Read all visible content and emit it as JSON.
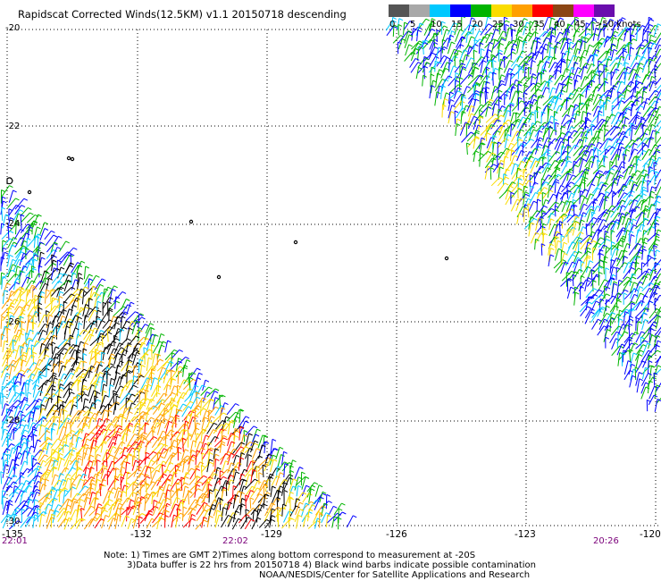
{
  "title": "Rapidscat Corrected Winds(12.5KM) v1.1 20150718 descending",
  "color_scale": {
    "labels": [
      "0",
      "5",
      "10",
      "15",
      "20",
      "25",
      "30",
      "35",
      "40",
      "45",
      ">50 knots"
    ],
    "colors": [
      "#555555",
      "#a8a8a8",
      "#00c8ff",
      "#0000ff",
      "#00b400",
      "#fadc00",
      "#ffa000",
      "#ff0000",
      "#8b4513",
      "#ff00ff",
      "#6a0dad"
    ]
  },
  "axes": {
    "lat_labels": [
      "-20",
      "-22",
      "-24",
      "-26",
      "-28",
      "-30"
    ],
    "lon_labels": [
      "-135",
      "-132",
      "-129",
      "-126",
      "-123",
      "-120"
    ]
  },
  "time_labels": [
    "22:01",
    "22:02",
    "20:26"
  ],
  "notes": {
    "line1": "Note: 1) Times are GMT 2)Times along bottom correspond to measurement at -20S",
    "line2": "3)Data buffer is 22 hrs from 20150718 4) Black wind barbs indicate possible contamination",
    "line3": "NOAA/NESDIS/Center for Satellite Applications and Research"
  }
}
